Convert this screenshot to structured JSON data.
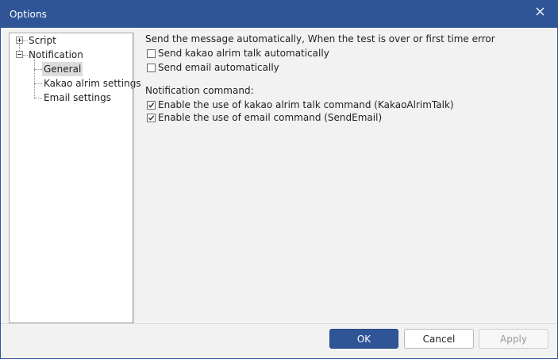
{
  "window": {
    "title": "Options",
    "close_icon": "close-icon"
  },
  "tree": {
    "items": [
      {
        "label": "Script",
        "expander": "plus"
      },
      {
        "label": "Notification",
        "expander": "minus"
      },
      {
        "label": "General",
        "selected": true
      },
      {
        "label": "Kakao alrim settings"
      },
      {
        "label": "Email settings"
      }
    ]
  },
  "general": {
    "auto_send_heading": "Send the message automatically, When the test is over or first time error",
    "kakao_auto": {
      "label": "Send kakao alrim talk automatically",
      "checked": false
    },
    "email_auto": {
      "label": "Send email automatically",
      "checked": false
    },
    "command_heading": "Notification command:",
    "kakao_command": {
      "label": "Enable the use of kakao alrim talk command (KakaoAlrimTalk)",
      "checked": true
    },
    "email_command": {
      "label": "Enable the use of email command (SendEmail)",
      "checked": true
    }
  },
  "buttons": {
    "ok": "OK",
    "cancel": "Cancel",
    "apply": "Apply"
  },
  "colors": {
    "accent": "#2f5597",
    "selection": "#dcdcdc"
  }
}
